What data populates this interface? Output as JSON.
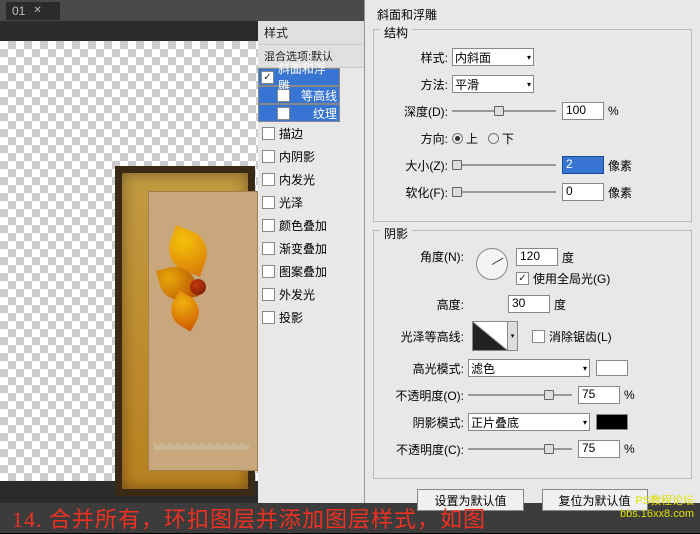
{
  "tab": {
    "label": "01",
    "close": "✕"
  },
  "styles_panel": {
    "title": "样式",
    "blend_label": "混合选项:默认",
    "rows": [
      {
        "name": "bevel",
        "label": "斜面和浮雕",
        "checked": true,
        "selected": true,
        "indent": false
      },
      {
        "name": "contour",
        "label": "等高线",
        "checked": false,
        "selected": true,
        "indent": true
      },
      {
        "name": "texture",
        "label": "纹理",
        "checked": false,
        "selected": true,
        "indent": true
      },
      {
        "name": "stroke",
        "label": "描边",
        "checked": false,
        "selected": false,
        "indent": false
      },
      {
        "name": "inner-shadow",
        "label": "内阴影",
        "checked": false,
        "selected": false,
        "indent": false
      },
      {
        "name": "inner-glow",
        "label": "内发光",
        "checked": false,
        "selected": false,
        "indent": false
      },
      {
        "name": "satin",
        "label": "光泽",
        "checked": false,
        "selected": false,
        "indent": false
      },
      {
        "name": "color-overlay",
        "label": "颜色叠加",
        "checked": false,
        "selected": false,
        "indent": false
      },
      {
        "name": "gradient-overlay",
        "label": "渐变叠加",
        "checked": false,
        "selected": false,
        "indent": false
      },
      {
        "name": "pattern-overlay",
        "label": "图案叠加",
        "checked": false,
        "selected": false,
        "indent": false
      },
      {
        "name": "outer-glow",
        "label": "外发光",
        "checked": false,
        "selected": false,
        "indent": false
      },
      {
        "name": "drop-shadow",
        "label": "投影",
        "checked": false,
        "selected": false,
        "indent": false
      }
    ]
  },
  "right_panel": {
    "title": "斜面和浮雕",
    "structure": {
      "legend": "结构",
      "style_label": "样式:",
      "style_value": "内斜面",
      "method_label": "方法:",
      "method_value": "平滑",
      "depth_label": "深度(D):",
      "depth_value": "100",
      "depth_unit": "%",
      "direction_label": "方向:",
      "up": "上",
      "down": "下",
      "size_label": "大小(Z):",
      "size_value": "2",
      "size_unit": "像素",
      "soften_label": "软化(F):",
      "soften_value": "0",
      "soften_unit": "像素"
    },
    "shading": {
      "legend": "阴影",
      "angle_label": "角度(N):",
      "angle_value": "120",
      "angle_unit": "度",
      "global_light": "使用全局光(G)",
      "altitude_label": "高度:",
      "altitude_value": "30",
      "altitude_unit": "度",
      "gloss_label": "光泽等高线:",
      "anti_alias": "消除锯齿(L)",
      "highlight_mode_label": "高光模式:",
      "highlight_mode_value": "滤色",
      "opacity1_label": "不透明度(O):",
      "opacity1_value": "75",
      "opacity1_unit": "%",
      "shadow_mode_label": "阴影模式:",
      "shadow_mode_value": "正片叠底",
      "opacity2_label": "不透明度(C):",
      "opacity2_value": "75",
      "opacity2_unit": "%"
    },
    "buttons": {
      "default": "设置为默认值",
      "reset": "复位为默认值"
    }
  },
  "caption": "14. 合并所有，环扣图层并添加图层样式，如图",
  "watermark": "PS教程论坛\nbbs.16xx8.com"
}
